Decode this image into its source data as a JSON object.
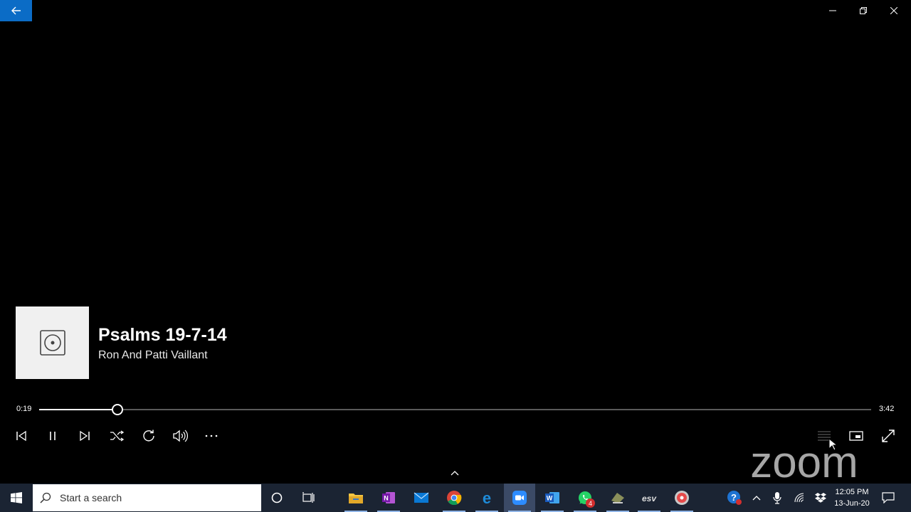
{
  "window": {
    "back_label": "Back",
    "minimize_label": "Minimize",
    "maximize_label": "Restore",
    "close_label": "Close"
  },
  "track": {
    "title": "Psalms 19-7-14",
    "artist": "Ron And Patti Vaillant"
  },
  "playback": {
    "elapsed": "0:19",
    "total": "3:42",
    "progress_fraction": 0.0941
  },
  "controls": {
    "icons": [
      "previous-icon",
      "pause-icon",
      "next-icon",
      "shuffle-icon",
      "repeat-icon",
      "volume-icon",
      "more-icon",
      "playlist-icon",
      "mini-view-icon",
      "fullscreen-icon"
    ]
  },
  "overlay": {
    "logo_text": "zoom"
  },
  "taskbar": {
    "search_placeholder": "Start a search",
    "apps": [
      "file-explorer",
      "onenote",
      "mail",
      "chrome",
      "edge",
      "zoom",
      "word",
      "whatsapp",
      "app-8",
      "app-9",
      "groove-music"
    ],
    "whatsapp_badge": "4",
    "clock_time": "12:05 PM",
    "clock_date": "13-Jun-20"
  },
  "colors": {
    "accent": "#0b6cc6",
    "taskbar": "#1b2433",
    "background": "#000000"
  }
}
